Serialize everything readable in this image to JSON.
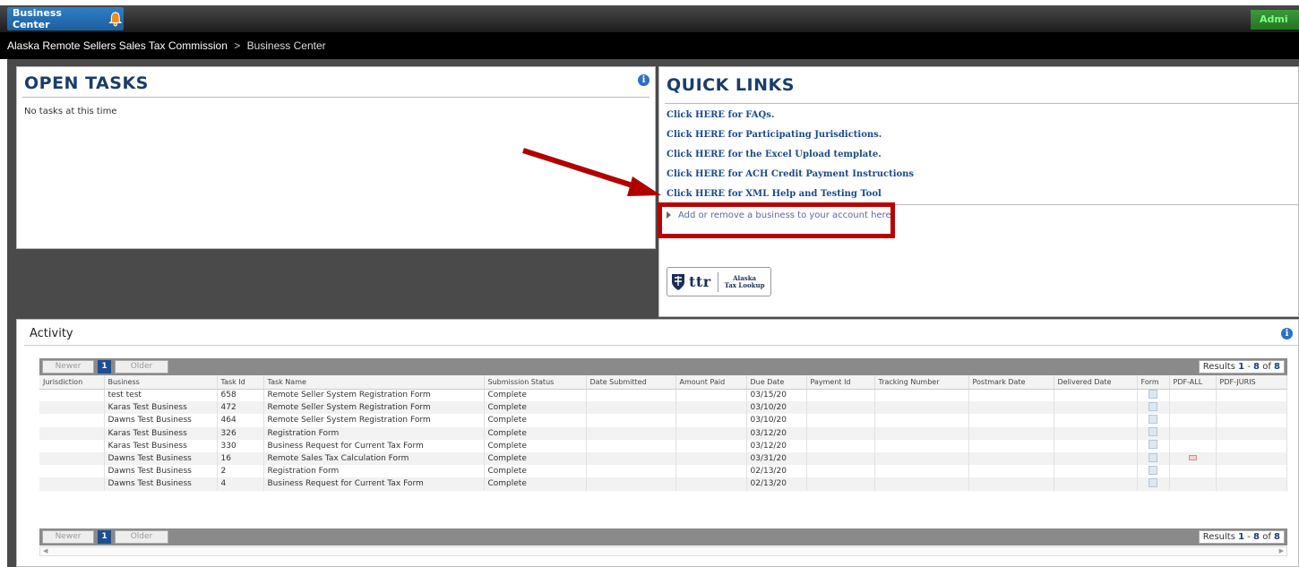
{
  "topbar": {
    "business_center_label": "Business Center",
    "admin_label": "Admi"
  },
  "breadcrumb": {
    "root": "Alaska Remote Sellers Sales Tax Commission",
    "separator": ">",
    "current": "Business Center"
  },
  "open_tasks": {
    "title": "OPEN TASKS",
    "empty_message": "No tasks at this time"
  },
  "quick_links": {
    "title": "QUICK LINKS",
    "links": [
      "Click HERE for FAQs.",
      "Click HERE for Participating Jurisdictions.",
      "Click HERE for the Excel Upload template.",
      "Click HERE for ACH Credit Payment Instructions",
      "Click HERE for XML Help and Testing Tool"
    ],
    "add_remove": "Add or remove a business to your account here.",
    "logo_text": "ttr",
    "logo_sub": [
      "Alaska",
      "Tax Lookup"
    ]
  },
  "activity": {
    "title": "Activity",
    "pager": {
      "newer": "Newer",
      "page": "1",
      "older": "Older",
      "results_prefix": "Results",
      "from": "1",
      "dash": "-",
      "to": "8",
      "of_label": "of",
      "total": "8"
    },
    "columns": [
      "Jurisdiction",
      "Business",
      "Task Id",
      "Task Name",
      "Submission Status",
      "Date Submitted",
      "Amount Paid",
      "Due Date",
      "Payment Id",
      "Tracking Number",
      "Postmark Date",
      "Delivered Date",
      "Form",
      "PDF-ALL",
      "PDF-JURIS"
    ],
    "rows": [
      {
        "jurisdiction": "",
        "business": "test test",
        "task_id": "658",
        "task_name": "Remote Seller System Registration Form",
        "status": "Complete",
        "date_submitted": "",
        "amount_paid": "",
        "due_date": "03/15/20",
        "payment_id": "",
        "tracking": "",
        "postmark": "",
        "delivered": "",
        "pdf_all": false
      },
      {
        "jurisdiction": "",
        "business": "Karas Test Business",
        "task_id": "472",
        "task_name": "Remote Seller System Registration Form",
        "status": "Complete",
        "date_submitted": "",
        "amount_paid": "",
        "due_date": "03/10/20",
        "payment_id": "",
        "tracking": "",
        "postmark": "",
        "delivered": "",
        "pdf_all": false
      },
      {
        "jurisdiction": "",
        "business": "Dawns Test Business",
        "task_id": "464",
        "task_name": "Remote Seller System Registration Form",
        "status": "Complete",
        "date_submitted": "",
        "amount_paid": "",
        "due_date": "03/10/20",
        "payment_id": "",
        "tracking": "",
        "postmark": "",
        "delivered": "",
        "pdf_all": false
      },
      {
        "jurisdiction": "",
        "business": "Karas Test Business",
        "task_id": "326",
        "task_name": "Registration Form",
        "status": "Complete",
        "date_submitted": "",
        "amount_paid": "",
        "due_date": "03/12/20",
        "payment_id": "",
        "tracking": "",
        "postmark": "",
        "delivered": "",
        "pdf_all": false
      },
      {
        "jurisdiction": "",
        "business": "Karas Test Business",
        "task_id": "330",
        "task_name": "Business Request for Current Tax Form",
        "status": "Complete",
        "date_submitted": "",
        "amount_paid": "",
        "due_date": "03/12/20",
        "payment_id": "",
        "tracking": "",
        "postmark": "",
        "delivered": "",
        "pdf_all": false
      },
      {
        "jurisdiction": "",
        "business": "Dawns Test Business",
        "task_id": "16",
        "task_name": "Remote Sales Tax Calculation Form",
        "status": "Complete",
        "date_submitted": "",
        "amount_paid": "",
        "due_date": "03/31/20",
        "payment_id": "",
        "tracking": "",
        "postmark": "",
        "delivered": "",
        "pdf_all": true
      },
      {
        "jurisdiction": "",
        "business": "Dawns Test Business",
        "task_id": "2",
        "task_name": "Registration Form",
        "status": "Complete",
        "date_submitted": "",
        "amount_paid": "",
        "due_date": "02/13/20",
        "payment_id": "",
        "tracking": "",
        "postmark": "",
        "delivered": "",
        "pdf_all": false
      },
      {
        "jurisdiction": "",
        "business": "Dawns Test Business",
        "task_id": "4",
        "task_name": "Business Request for Current Tax Form",
        "status": "Complete",
        "date_submitted": "",
        "amount_paid": "",
        "due_date": "02/13/20",
        "payment_id": "",
        "tracking": "",
        "postmark": "",
        "delivered": "",
        "pdf_all": false
      }
    ]
  },
  "colors": {
    "annotation_red": "#b00000",
    "heading_navy": "#1a3d6a",
    "link_blue": "#1a4a8a",
    "accent_blue": "#2a72c4"
  }
}
